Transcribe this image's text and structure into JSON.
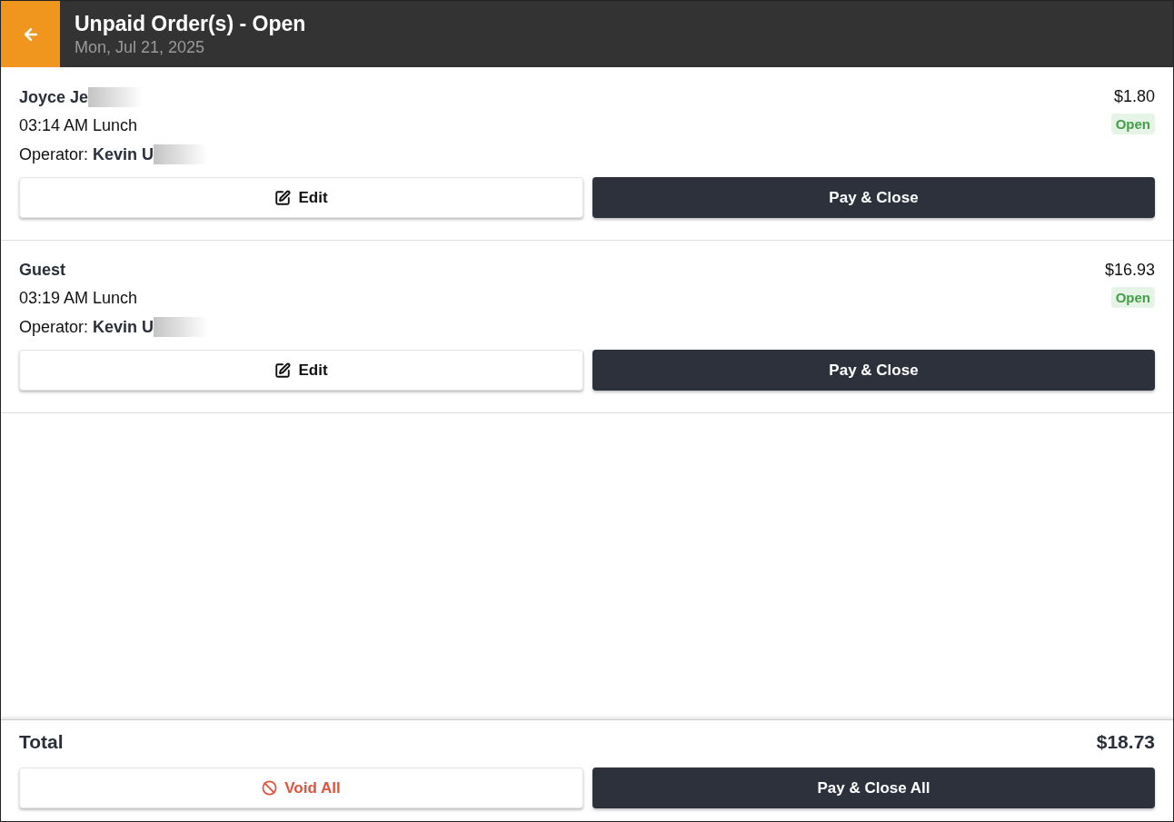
{
  "header": {
    "title": "Unpaid Order(s) - Open",
    "subtitle": "Mon, Jul 21, 2025"
  },
  "orders": [
    {
      "customer": "Joyce Je",
      "customer_redacted": true,
      "time": "03:14 AM Lunch",
      "operator_label": "Operator:",
      "operator": "Kevin U",
      "amount": "$1.80",
      "status": "Open",
      "edit": "Edit",
      "pay": "Pay & Close"
    },
    {
      "customer": "Guest",
      "customer_redacted": false,
      "time": "03:19 AM Lunch",
      "operator_label": "Operator:",
      "operator": "Kevin U",
      "amount": "$16.93",
      "status": "Open",
      "edit": "Edit",
      "pay": "Pay & Close"
    }
  ],
  "footer": {
    "total_label": "Total",
    "total": "$18.73",
    "void": "Void All",
    "pay_all": "Pay & Close All"
  }
}
